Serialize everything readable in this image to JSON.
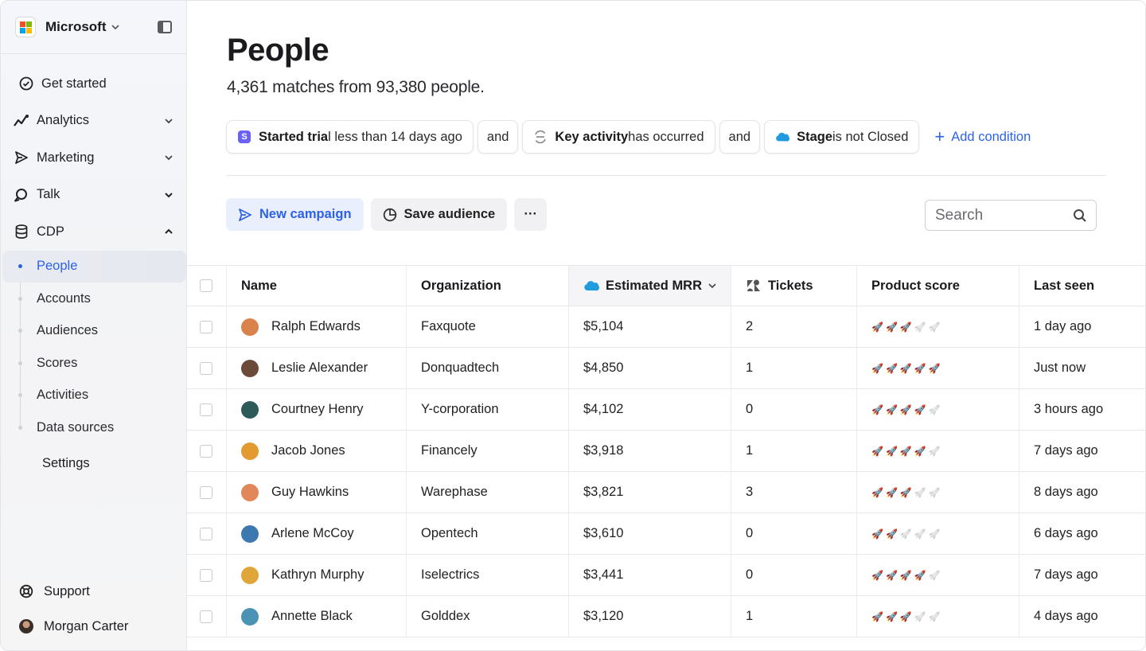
{
  "workspace": {
    "name": "Microsoft"
  },
  "nav": {
    "get_started": "Get started",
    "analytics": "Analytics",
    "marketing": "Marketing",
    "talk": "Talk",
    "cdp": "CDP",
    "cdp_items": [
      "People",
      "Accounts",
      "Audiences",
      "Scores",
      "Activities",
      "Data sources"
    ],
    "settings": "Settings",
    "support": "Support",
    "user": "Morgan Carter"
  },
  "page": {
    "title": "People",
    "subtitle": "4,361 matches from 93,380 people."
  },
  "filters": {
    "cond1_bold": "Started tria",
    "cond1_rest": "l less than 14 days ago",
    "and1": "and",
    "cond2_bold": "Key activity",
    "cond2_rest": " has occurred",
    "and2": "and",
    "cond3_bold": "Stage",
    "cond3_rest": " is not Closed",
    "add": "Add condition"
  },
  "toolbar": {
    "new_campaign": "New campaign",
    "save_audience": "Save audience",
    "more": "···",
    "search_placeholder": "Search"
  },
  "table": {
    "columns": [
      "Name",
      "Organization",
      "Estimated MRR",
      "Tickets",
      "Product score",
      "Last seen"
    ],
    "rows": [
      {
        "name": "Ralph Edwards",
        "org": "Faxquote",
        "mrr": "$5,104",
        "tickets": "2",
        "score": 3,
        "seen": "1 day ago",
        "avatar": "#d9824b"
      },
      {
        "name": "Leslie Alexander",
        "org": "Donquadtech",
        "mrr": "$4,850",
        "tickets": "1",
        "score": 5,
        "seen": "Just now",
        "avatar": "#6b4a3a"
      },
      {
        "name": "Courtney Henry",
        "org": "Y-corporation",
        "mrr": "$4,102",
        "tickets": "0",
        "score": 4,
        "seen": "3 hours ago",
        "avatar": "#2f5a5a"
      },
      {
        "name": "Jacob Jones",
        "org": "Financely",
        "mrr": "$3,918",
        "tickets": "1",
        "score": 4,
        "seen": "7 days ago",
        "avatar": "#e39a2f"
      },
      {
        "name": "Guy Hawkins",
        "org": "Warephase",
        "mrr": "$3,821",
        "tickets": "3",
        "score": 3,
        "seen": "8 days ago",
        "avatar": "#e2875a"
      },
      {
        "name": "Arlene McCoy",
        "org": "Opentech",
        "mrr": "$3,610",
        "tickets": "0",
        "score": 2,
        "seen": "6 days ago",
        "avatar": "#3d78b0"
      },
      {
        "name": "Kathryn Murphy",
        "org": "Iselectrics",
        "mrr": "$3,441",
        "tickets": "0",
        "score": 4,
        "seen": "7 days ago",
        "avatar": "#e0a63a"
      },
      {
        "name": "Annette Black",
        "org": "Golddex",
        "mrr": "$3,120",
        "tickets": "1",
        "score": 3,
        "seen": "4 days ago",
        "avatar": "#4b93b4"
      }
    ]
  },
  "colors": {
    "accent": "#2d62e6",
    "salesforce": "#1f9be0",
    "segment_badge": "#6a62f5"
  }
}
